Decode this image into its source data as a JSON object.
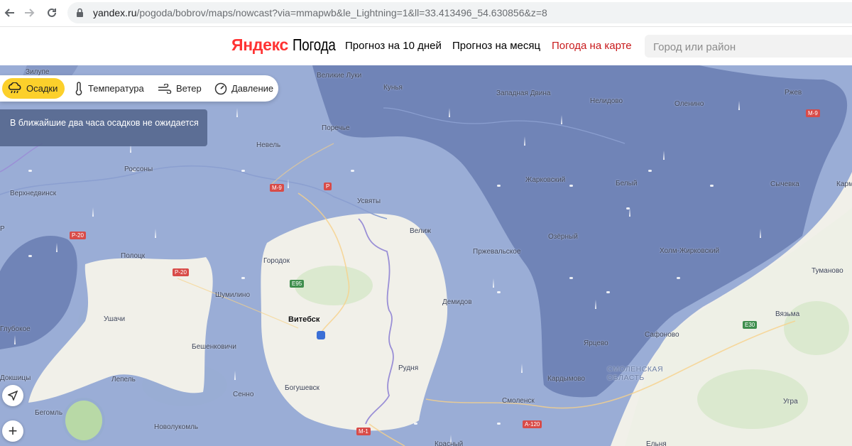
{
  "browser": {
    "url_host": "yandex.ru",
    "url_path": "/pogoda/bobrov/maps/nowcast?via=mmapwb&le_Lightning=1&ll=33.413496_54.630856&z=8",
    "back_icon": "back-arrow-icon",
    "forward_icon": "forward-arrow-icon",
    "reload_icon": "reload-icon"
  },
  "header": {
    "logo_brand": "Яндекс",
    "logo_product": "Погода",
    "nav": [
      {
        "label": "Прогноз на 10 дней",
        "active": false
      },
      {
        "label": "Прогноз на месяц",
        "active": false
      },
      {
        "label": "Погода на карте",
        "active": true
      }
    ],
    "search_placeholder": "Город или район"
  },
  "layers": [
    {
      "label": "Осадки",
      "icon": "rain-cloud-icon",
      "active": true
    },
    {
      "label": "Температура",
      "icon": "thermometer-icon",
      "active": false
    },
    {
      "label": "Ветер",
      "icon": "wind-icon",
      "active": false
    },
    {
      "label": "Давление",
      "icon": "gauge-icon",
      "active": false
    }
  ],
  "notice": {
    "text": "В ближайшие два часа осадков не ожидается"
  },
  "map_controls": {
    "locate_icon": "locate-arrow-icon",
    "zoom_in_label": "+"
  },
  "map": {
    "places": {
      "vitebsk": "Витебск",
      "velikie_luki": "Великие Луки",
      "kunya": "Кунья",
      "zapadnaya_dvina": "Западная Двина",
      "nelidovo": "Нелидово",
      "olenino": "Оленино",
      "rzhev": "Ржев",
      "nevel": "Невель",
      "pustoshka": "Поречье",
      "rossony": "Россоны",
      "verkhnedvinsk": "Верхнедвинск",
      "zilupe": "Зилупе",
      "usvyaty": "Усвяты",
      "zharkovsky": "Жарковский",
      "bely": "Белый",
      "sychevka": "Сычевка",
      "karm": "Карм",
      "velizh": "Велиж",
      "przhevalskoe": "Пржевальское",
      "ozerny": "Озёрный",
      "kholm_zhirkovsky": "Холм-Жирковский",
      "tumanovo": "Туманово",
      "polotsk": "Полоцк",
      "gorodok": "Городок",
      "shumilino": "Шумилино",
      "ushachi": "Ушачи",
      "beshenkovichi": "Бешенковичи",
      "demidov": "Демидов",
      "vyazma": "Вязьма",
      "safonovo": "Сафоново",
      "yartsevo": "Ярцево",
      "rudnya": "Рудня",
      "kardymovo": "Кардымово",
      "smolensk_region": "СМОЛЕНСКАЯ ОБЛАСТЬ",
      "lepel": "Лепель",
      "senno": "Сенно",
      "bogushevsk": "Богушевск",
      "smolensk": "Смоленск",
      "ugra": "Угра",
      "dokshitsy": "Докшицы",
      "begoml": "Бегомль",
      "novolukoml": "Новолукомль",
      "elnya": "Ельня",
      "krasny": "Красный",
      "glubokoe": "Глубокое",
      "kraslava": "Р"
    },
    "roads": {
      "p20_a": "Р-20",
      "p20_b": "Р-20",
      "e95": "E95",
      "m9": "М-9",
      "e30": "E30",
      "m1": "М-1",
      "a120": "А-120",
      "ru_shield": "Р",
      "m9b": "М-9"
    }
  }
}
